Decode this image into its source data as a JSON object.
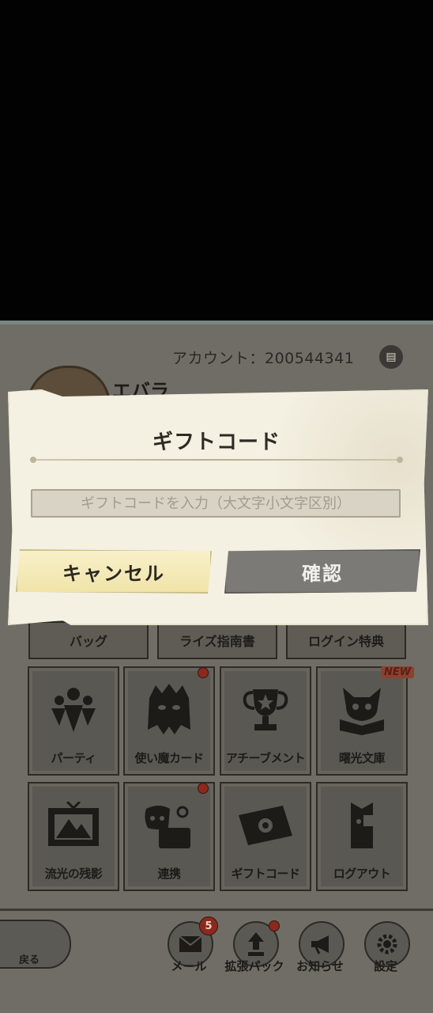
{
  "header": {
    "account_label": "アカウント：200544341",
    "player_name": "エバラ"
  },
  "menu": {
    "row_buttons": [
      "バッグ",
      "ライズ指南書",
      "ログイン特典"
    ],
    "tiles": [
      {
        "label": "パーティ",
        "icon": "party-icon"
      },
      {
        "label": "使い魔カード",
        "icon": "familiar-icon"
      },
      {
        "label": "アチーブメント",
        "icon": "trophy-icon"
      },
      {
        "label": "曙光文庫",
        "icon": "library-icon"
      },
      {
        "label": "流光の残影",
        "icon": "picture-frame-icon"
      },
      {
        "label": "連携",
        "icon": "discord-icon"
      },
      {
        "label": "ギフトコード",
        "icon": "ticket-icon"
      },
      {
        "label": "ログアウト",
        "icon": "logout-icon"
      }
    ],
    "new_badge": "NEW"
  },
  "bottom_bar": {
    "back_label": "戻る",
    "buttons": [
      {
        "label": "メール",
        "icon": "mail-icon"
      },
      {
        "label": "拡張パック",
        "icon": "expansion-icon"
      },
      {
        "label": "お知らせ",
        "icon": "megaphone-icon"
      },
      {
        "label": "設定",
        "icon": "gear-icon"
      }
    ],
    "mail_count": "5"
  },
  "dialog": {
    "title": "ギフトコード",
    "input_placeholder": "ギフトコードを入力（大文字小文字区別）",
    "input_value": "",
    "cancel_label": "キャンセル",
    "confirm_label": "確認"
  },
  "colors": {
    "dialog_bg": "#f4f0e2",
    "cancel_bg": "#f0e4a9",
    "confirm_bg": "#7b7a77",
    "badge_red": "#8b2a1c"
  }
}
